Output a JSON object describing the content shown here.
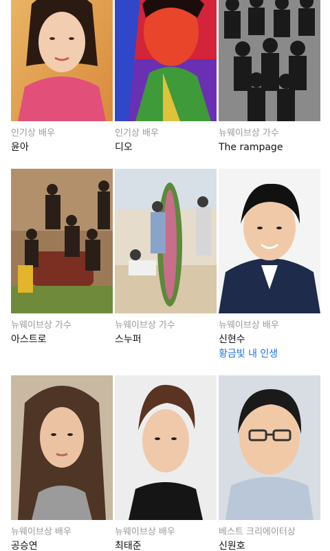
{
  "colors": {
    "category": "#999999",
    "name": "#111111",
    "link": "#1a73e8"
  },
  "cards": [
    {
      "category": "인기상 배우",
      "name": "윤아"
    },
    {
      "category": "인기상 배우",
      "name": "디오"
    },
    {
      "category": "뉴웨이브상 가수",
      "name": "The rampage"
    },
    {
      "category": "뉴웨이브상 가수",
      "name": "아스트로"
    },
    {
      "category": "뉴웨이브상 가수",
      "name": "스누퍼"
    },
    {
      "category": "뉴웨이브상 배우",
      "name": "신현수",
      "work": "황금빛 내 인생"
    },
    {
      "category": "뉴웨이브상 배우",
      "name": "공승연"
    },
    {
      "category": "뉴웨이브상 배우",
      "name": "최태준"
    },
    {
      "category": "베스트 크리에이터상",
      "name": "신원호"
    }
  ]
}
